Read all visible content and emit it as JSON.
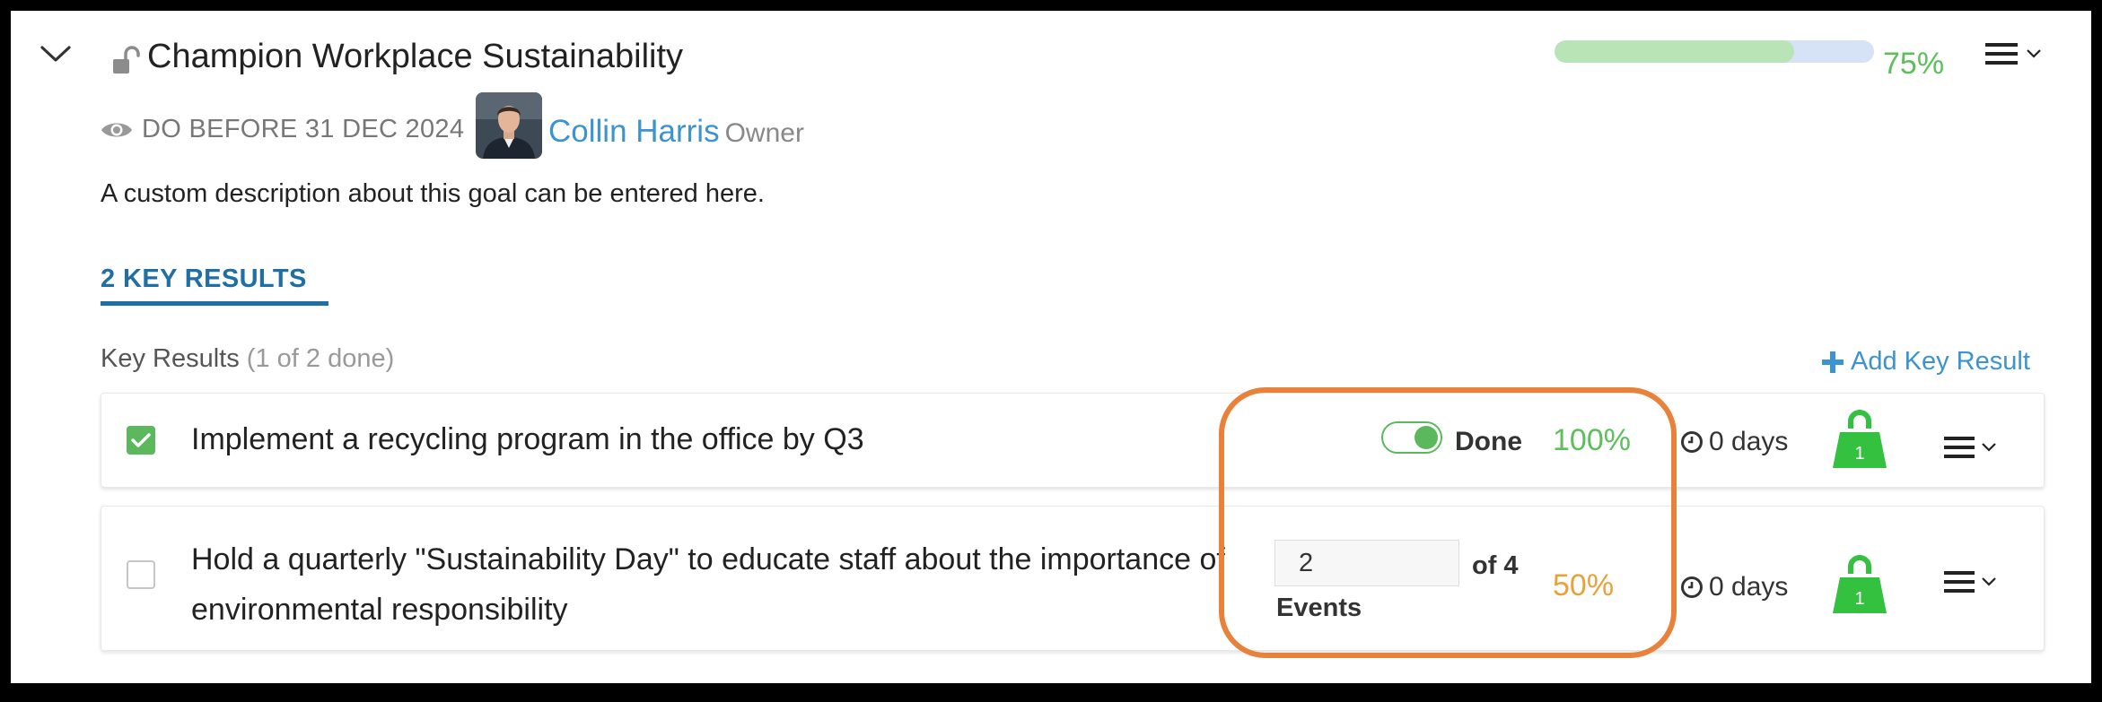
{
  "goal": {
    "title": "Champion Workplace Sustainability",
    "progress": 0.75,
    "progress_label": "75%",
    "do_before": "DO BEFORE 31 DEC 2024",
    "owner_name": "Collin Harris",
    "owner_role": "Owner",
    "description": "A custom description about this goal can be entered here."
  },
  "tabs": {
    "key_results": "2 KEY RESULTS"
  },
  "key_results_header": {
    "label": "Key Results",
    "count": "(1 of 2 done)"
  },
  "add_key_result": "Add Key Result",
  "key_results": [
    {
      "text": "Implement a recycling program in the office by Q3",
      "checked": true,
      "status": "Done",
      "percent": "100%",
      "percent_color": "#5cbf5b",
      "days": "0 days",
      "weight": "1"
    },
    {
      "text_line1": "Hold a quarterly \"Sustainability Day\" to educate staff about the importance of",
      "text_line2": "environmental responsibility",
      "checked": false,
      "current_value": "2",
      "of_label": "of 4",
      "unit": "Events",
      "percent": "50%",
      "percent_color": "#e9a23b",
      "days": "0 days",
      "weight": "1"
    }
  ],
  "icons": {
    "collapse": "chevron-down-icon",
    "lock": "unlock-icon",
    "visibility": "eye-icon",
    "menu": "hamburger-icon",
    "clock": "clock-icon",
    "weight": "weight-icon",
    "add": "plus-icon",
    "check": "check-icon"
  },
  "colors": {
    "accent_green": "#5cb85c",
    "link_blue": "#3b93d0",
    "tab_blue": "#1f6fa5",
    "progress_fill": "#b9e5b6",
    "progress_track": "#d6e2f5",
    "highlight": "#e8813a",
    "percent_warn": "#e9a23b"
  }
}
